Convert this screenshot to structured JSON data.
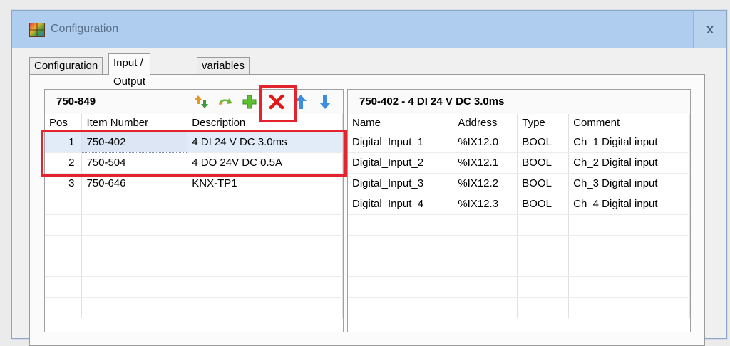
{
  "window": {
    "title": "Configuration",
    "close_label": "x"
  },
  "tabs": [
    "Configuration",
    "Input / Output",
    "variables"
  ],
  "left_pane": {
    "title": "750-849",
    "toolbar": [
      "sort-icon",
      "move-icon",
      "add-icon",
      "delete-icon",
      "arrow-up-icon",
      "arrow-down-icon"
    ],
    "columns": [
      "Pos",
      "Item Number",
      "Description"
    ],
    "rows": [
      {
        "pos": "1",
        "item": "750-402",
        "desc": "4 DI 24 V DC 3.0ms"
      },
      {
        "pos": "2",
        "item": "750-504",
        "desc": "4 DO 24V DC 0.5A"
      },
      {
        "pos": "3",
        "item": "750-646",
        "desc": "KNX-TP1"
      },
      {
        "pos": "",
        "item": "",
        "desc": ""
      },
      {
        "pos": "",
        "item": "",
        "desc": ""
      },
      {
        "pos": "",
        "item": "",
        "desc": ""
      },
      {
        "pos": "",
        "item": "",
        "desc": ""
      },
      {
        "pos": "",
        "item": "",
        "desc": ""
      },
      {
        "pos": "",
        "item": "",
        "desc": ""
      }
    ],
    "selected_row": "1"
  },
  "right_pane": {
    "title": "750-402 - 4 DI 24 V DC 3.0ms",
    "columns": [
      "Name",
      "Address",
      "Type",
      "Comment"
    ],
    "rows": [
      {
        "name": "Digital_Input_1",
        "address": "%IX12.0",
        "type": "BOOL",
        "comment": "Ch_1 Digital input"
      },
      {
        "name": "Digital_Input_2",
        "address": "%IX12.1",
        "type": "BOOL",
        "comment": "Ch_2 Digital input"
      },
      {
        "name": "Digital_Input_3",
        "address": "%IX12.2",
        "type": "BOOL",
        "comment": "Ch_3 Digital input"
      },
      {
        "name": "Digital_Input_4",
        "address": "%IX12.3",
        "type": "BOOL",
        "comment": "Ch_4 Digital input"
      },
      {
        "name": "",
        "address": "",
        "type": "",
        "comment": ""
      },
      {
        "name": "",
        "address": "",
        "type": "",
        "comment": ""
      },
      {
        "name": "",
        "address": "",
        "type": "",
        "comment": ""
      },
      {
        "name": "",
        "address": "",
        "type": "",
        "comment": ""
      },
      {
        "name": "",
        "address": "",
        "type": "",
        "comment": ""
      }
    ]
  },
  "colors": {
    "highlight": "#e1242e",
    "titlebar": "#aecdef",
    "selection": "#e2ecf9"
  }
}
